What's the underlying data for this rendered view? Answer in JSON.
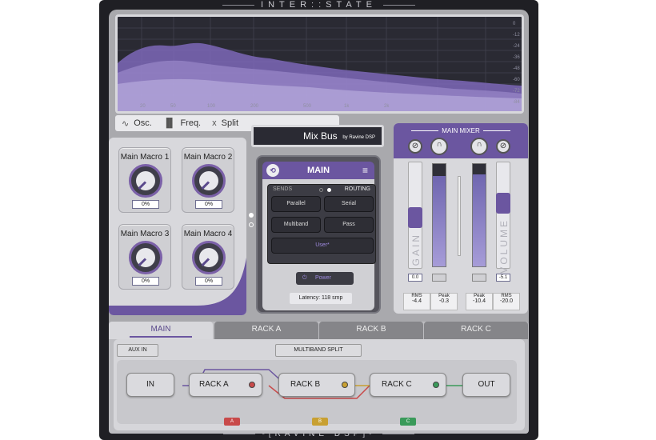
{
  "app": {
    "title": "INTER::STATE",
    "footer": "-[RAVINE DSP]-"
  },
  "analyzer": {
    "freq_labels": [
      "20",
      "50",
      "100",
      "200",
      "500",
      "1k",
      "2k"
    ],
    "db_labels": [
      "0",
      "-12",
      "-24",
      "-36",
      "-48",
      "-60",
      "-72",
      "-84"
    ],
    "tabs": [
      {
        "icon": "∿",
        "label": "Osc."
      },
      {
        "icon": "▐▌",
        "label": "Freq."
      },
      {
        "icon": "x",
        "label": "Split"
      }
    ]
  },
  "macros": [
    {
      "label": "Main Macro 1",
      "value": "0%"
    },
    {
      "label": "Main Macro 2",
      "value": "0%"
    },
    {
      "label": "Main Macro 3",
      "value": "0%"
    },
    {
      "label": "Main Macro 4",
      "value": "0%"
    }
  ],
  "bus": {
    "name": "Mix Bus",
    "by": "by Ravine DSP"
  },
  "main_card": {
    "title": "MAIN",
    "sends_label": "SENDS",
    "routing_label": "ROUTING",
    "buttons": [
      "Parallel",
      "Serial",
      "Multiband",
      "Pass"
    ],
    "user_label": "User*",
    "power_label": "Power",
    "latency": "Latency: 118 smp"
  },
  "mixer": {
    "title": "MAIN MIXER",
    "gain_word": "GAIN",
    "volume_word": "VOLUME",
    "gain_value": "0.0",
    "volume_value": "-5.1",
    "left_stats": [
      {
        "label": "RMS",
        "value": "-4.4"
      },
      {
        "label": "Peak",
        "value": "-0.3"
      }
    ],
    "right_stats": [
      {
        "label": "Peak",
        "value": "-10.4"
      },
      {
        "label": "RMS",
        "value": "-20.0"
      }
    ],
    "meter_levels": [
      0.88,
      0.82,
      0.9,
      0.85
    ]
  },
  "rack_tabs": [
    "MAIN",
    "RACK A",
    "RACK B",
    "RACK C"
  ],
  "chain": {
    "aux_in": "AUX IN",
    "multiband_split": "MULTIBAND SPLIT",
    "nodes": [
      "IN",
      "RACK A",
      "RACK B",
      "RACK C",
      "OUT"
    ],
    "tags": [
      "A",
      "B",
      "C"
    ]
  },
  "colors": {
    "accent": "#6b56a0",
    "rack_a": "#c84a4a",
    "rack_b": "#c8a032",
    "rack_c": "#3a9a5a"
  }
}
